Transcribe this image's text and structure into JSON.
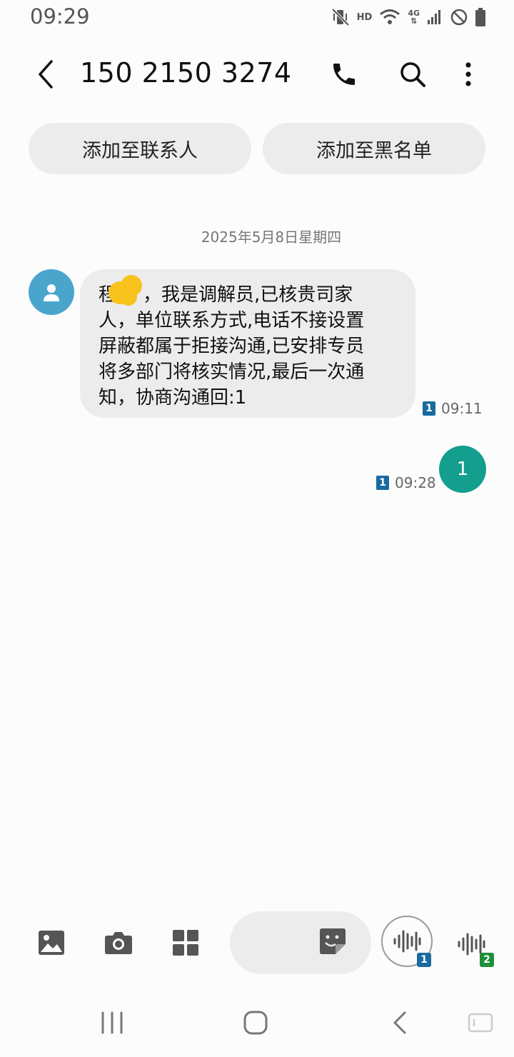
{
  "status": {
    "time": "09:29",
    "network": "HD",
    "network_type": "4G"
  },
  "header": {
    "title": "150 2150 3274"
  },
  "actions": {
    "add_contact": "添加至联系人",
    "add_blocklist": "添加至黑名单"
  },
  "conversation": {
    "date": "2025年5月8日星期四",
    "incoming": {
      "lines": [
        "，我是调解员,已核贵司家",
        "人，单位联系方式,电话不接设置",
        "屏蔽都属于拒接沟通,已安排专员",
        "将多部门将核实情况,最后一次通",
        "知，协商沟通回:1"
      ],
      "first_char": "程",
      "sim": "1",
      "time": "09:11"
    },
    "outgoing": {
      "text": "1",
      "sim": "1",
      "time": "09:28"
    }
  },
  "composer": {
    "placeholder": "",
    "voice_sim1": "1",
    "voice_sim2": "2"
  },
  "colors": {
    "accent": "#139e8e",
    "avatar": "#4aa5cc",
    "sim1": "#1a6aa0",
    "sim2": "#1f8f3a",
    "bubble": "#ececec"
  }
}
